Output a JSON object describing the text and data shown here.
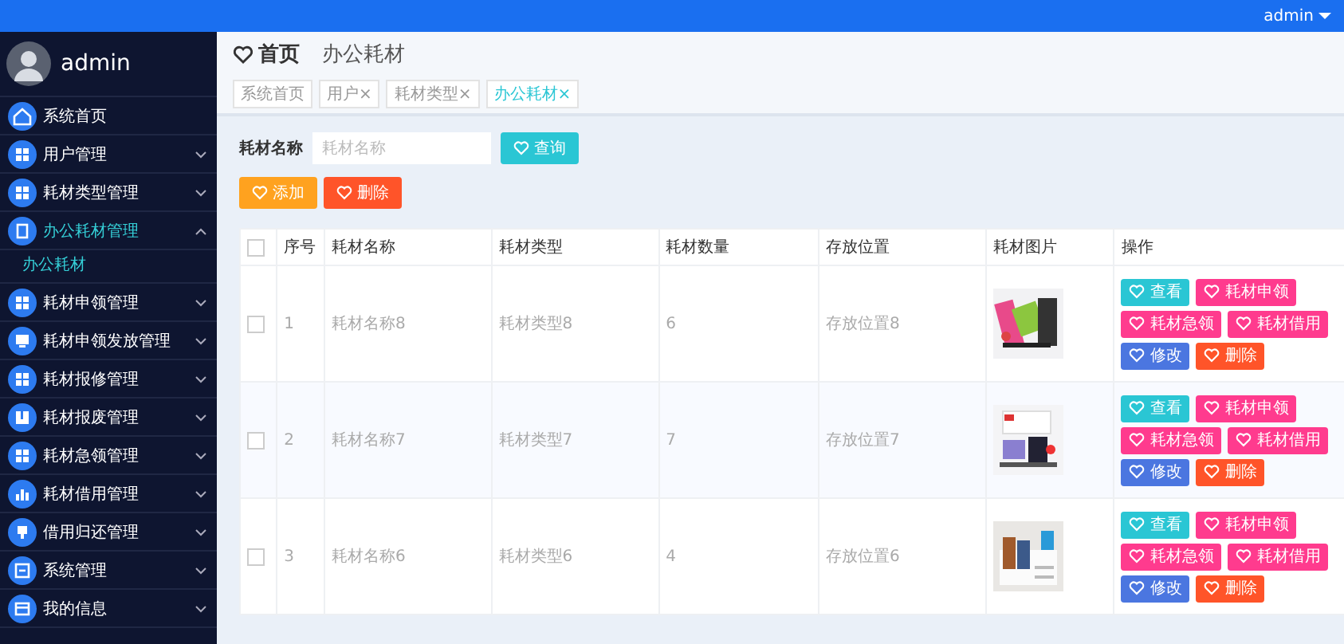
{
  "top_bar": {
    "user": "admin"
  },
  "sidebar": {
    "user": "admin",
    "items": [
      {
        "label": "系统首页"
      },
      {
        "label": "用户管理",
        "expanded": false
      },
      {
        "label": "耗材类型管理",
        "expanded": false
      },
      {
        "label": "办公耗材管理",
        "expanded": true,
        "children": [
          {
            "label": "办公耗材",
            "selected": true
          }
        ]
      },
      {
        "label": "耗材申领管理",
        "expanded": false
      },
      {
        "label": "耗材申领发放管理",
        "expanded": false
      },
      {
        "label": "耗材报修管理",
        "expanded": false
      },
      {
        "label": "耗材报废管理",
        "expanded": false
      },
      {
        "label": "耗材急领管理",
        "expanded": false
      },
      {
        "label": "耗材借用管理",
        "expanded": false
      },
      {
        "label": "借用归还管理",
        "expanded": false
      },
      {
        "label": "系统管理",
        "expanded": false
      },
      {
        "label": "我的信息",
        "expanded": false
      }
    ]
  },
  "breadcrumb": [
    "首页",
    "办公耗材"
  ],
  "tags": [
    {
      "label": "系统首页",
      "selected": false
    },
    {
      "label": "用户×",
      "selected": false
    },
    {
      "label": "耗材类型×",
      "selected": false
    },
    {
      "label": "办公耗材×",
      "selected": true
    }
  ],
  "search": {
    "label": "耗材名称",
    "placeholder": "耗材名称",
    "button": "查询"
  },
  "actions": [
    {
      "label": "添加",
      "kind": "add"
    },
    {
      "label": "删除",
      "kind": "delete"
    }
  ],
  "table": {
    "all_checked": false,
    "columns": [
      "序号",
      "耗材名称",
      "耗材类型",
      "耗材数量",
      "存放位置",
      "耗材图片",
      "操作"
    ],
    "rows": [
      {
        "checked": false,
        "cells": [
          "1",
          "耗材名称8",
          "耗材类型8",
          "6",
          "存放位置8"
        ],
        "buttons": [
          {
            "label": "查看",
            "kind": "view"
          },
          {
            "label": "耗材申领",
            "kind": "apply"
          },
          {
            "label": "耗材急领",
            "kind": "urgent"
          },
          {
            "label": "耗材借用",
            "kind": "borrow"
          },
          {
            "label": "修改",
            "kind": "edit"
          },
          {
            "label": "删除",
            "kind": "delete"
          }
        ]
      },
      {
        "checked": false,
        "cells": [
          "2",
          "耗材名称7",
          "耗材类型7",
          "7",
          "存放位置7"
        ],
        "buttons": [
          {
            "label": "查看",
            "kind": "view"
          },
          {
            "label": "耗材申领",
            "kind": "apply"
          },
          {
            "label": "耗材急领",
            "kind": "urgent"
          },
          {
            "label": "耗材借用",
            "kind": "borrow"
          },
          {
            "label": "修改",
            "kind": "edit"
          },
          {
            "label": "删除",
            "kind": "delete"
          }
        ]
      },
      {
        "checked": false,
        "cells": [
          "3",
          "耗材名称6",
          "耗材类型6",
          "4",
          "存放位置6"
        ],
        "buttons": [
          {
            "label": "查看",
            "kind": "view"
          },
          {
            "label": "耗材申领",
            "kind": "apply"
          },
          {
            "label": "耗材急领",
            "kind": "urgent"
          },
          {
            "label": "耗材借用",
            "kind": "borrow"
          },
          {
            "label": "修改",
            "kind": "edit"
          },
          {
            "label": "删除",
            "kind": "delete"
          }
        ]
      }
    ]
  }
}
